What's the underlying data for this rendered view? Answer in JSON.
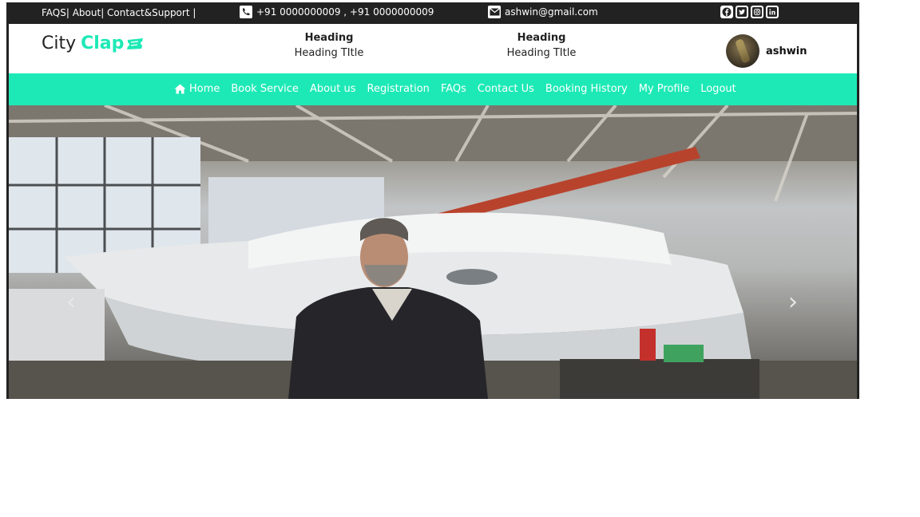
{
  "topbar": {
    "links": "FAQS| About| Contact&Support |",
    "phones": "+91 0000000009 , +91 0000000009",
    "email": "ashwin@gmail.com",
    "socials": [
      "facebook-icon",
      "twitter-icon",
      "instagram-icon",
      "linkedin-icon"
    ]
  },
  "header": {
    "logo_city": "City",
    "logo_clap": "Clap",
    "col1": {
      "heading": "Heading",
      "title": "Heading TItle"
    },
    "col2": {
      "heading": "Heading",
      "title": "Heading TItle"
    },
    "user_name": "ashwin"
  },
  "nav": {
    "items": [
      "Home",
      "Book Service",
      "About us",
      "Registration",
      "FAQs",
      "Contact Us",
      "Booking History",
      "My Profile",
      "Logout"
    ]
  },
  "carousel": {
    "prev_label": "‹",
    "next_label": "›"
  },
  "colors": {
    "accent": "#1de9b6",
    "topbar": "#222222"
  }
}
